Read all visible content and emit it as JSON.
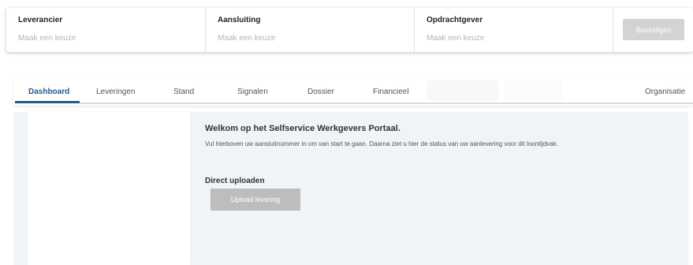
{
  "selectors": [
    {
      "label": "Leverancier",
      "placeholder": "Maak een keuze"
    },
    {
      "label": "Aansluiting",
      "placeholder": "Maak een keuze"
    },
    {
      "label": "Opdrachtgever",
      "placeholder": "Maak een keuze"
    }
  ],
  "confirm_label": "Bevestigen",
  "tabs": [
    {
      "label": "Dashboard",
      "active": true
    },
    {
      "label": "Leveringen"
    },
    {
      "label": "Stand"
    },
    {
      "label": "Signalen"
    },
    {
      "label": "Dossier"
    },
    {
      "label": "Financieel"
    },
    {
      "label": "Organisatie"
    }
  ],
  "welcome": {
    "title": "Welkom op het Selfservice Werkgevers Portaal.",
    "text": "Vul hierboven uw aansluitnummer in om van start te gaan. Daarna ziet u hier de status van uw aanlevering voor dit loontijdvak."
  },
  "upload": {
    "title": "Direct uploaden",
    "button_label": "Upload levering"
  },
  "colors": {
    "accent": "#1f5b8f",
    "panel_bg": "#f0f3f7",
    "button_disabled": "#bdbdbd"
  }
}
